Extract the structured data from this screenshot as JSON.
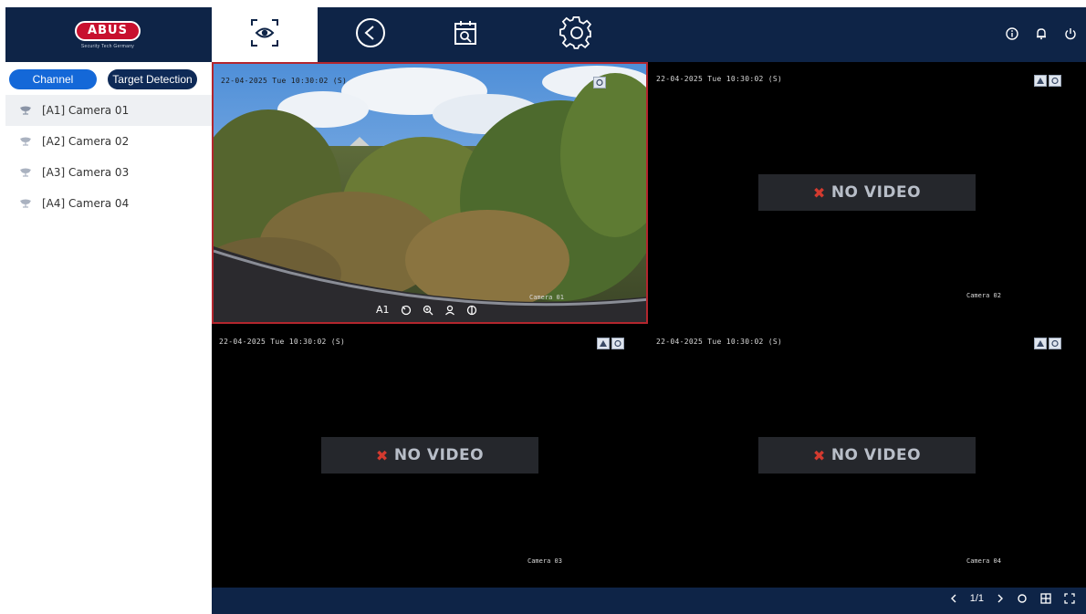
{
  "app": {
    "brand": "ABUS",
    "brand_tagline": "Security Tech Germany"
  },
  "nav": {
    "items": [
      {
        "id": "live",
        "icon": "live-view-icon",
        "active": true
      },
      {
        "id": "playback",
        "icon": "playback-icon",
        "active": false
      },
      {
        "id": "search",
        "icon": "calendar-search-icon",
        "active": false
      },
      {
        "id": "settings",
        "icon": "gear-icon",
        "active": false
      }
    ],
    "right_icons": [
      "info-icon",
      "bell-icon",
      "power-icon"
    ]
  },
  "sidebar": {
    "tabs": {
      "channel": "Channel",
      "target": "Target Detection"
    },
    "cameras": [
      {
        "label": "[A1] Camera 01",
        "selected": true
      },
      {
        "label": "[A2] Camera 02",
        "selected": false
      },
      {
        "label": "[A3] Camera 03",
        "selected": false
      },
      {
        "label": "[A4] Camera 04",
        "selected": false
      }
    ]
  },
  "panes": [
    {
      "timestamp": "22-04-2025 Tue  10:30:02 (S)",
      "name": "Camera 01",
      "has_video": true
    },
    {
      "timestamp": "22-04-2025 Tue  10:30:02 (S)",
      "name": "Camera 02",
      "has_video": false
    },
    {
      "timestamp": "22-04-2025 Tue  10:30:02 (S)",
      "name": "Camera 03",
      "has_video": false
    },
    {
      "timestamp": "22-04-2025 Tue  10:30:02 (S)",
      "name": "Camera 04",
      "has_video": false
    }
  ],
  "no_video_text": "NO VIDEO",
  "pane_toolbar": {
    "channel_label": "A1"
  },
  "bottombar": {
    "page_indicator": "1/1"
  },
  "colors": {
    "navy": "#0e2447",
    "accent_blue": "#1468d8",
    "selection_border": "#b3262e",
    "no_video_x": "#d33a2f"
  }
}
